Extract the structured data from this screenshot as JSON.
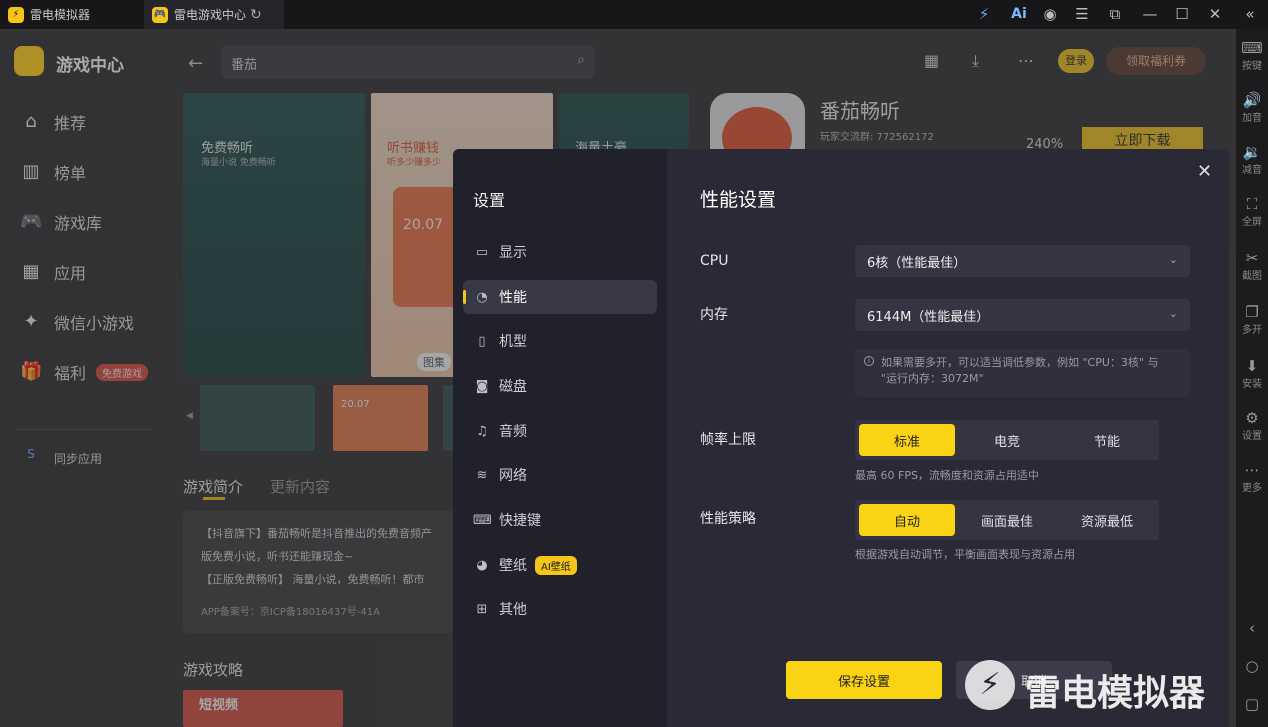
{
  "titlebar": {
    "tab1": "雷电模拟器",
    "tab2": "雷电游戏中心",
    "tab2_icon": "刷"
  },
  "rightbar": [
    {
      "icon": "⌨",
      "label": "按键"
    },
    {
      "icon": "🔊",
      "label": "加音"
    },
    {
      "icon": "🔉",
      "label": "减音"
    },
    {
      "icon": "⛶",
      "label": "全屏"
    },
    {
      "icon": "✂",
      "label": "截图"
    },
    {
      "icon": "❐",
      "label": "多开"
    },
    {
      "icon": "⬇",
      "label": "安装"
    },
    {
      "icon": "⚙",
      "label": "设置"
    },
    {
      "icon": "⋯",
      "label": "更多"
    }
  ],
  "nav": {
    "app_title": "游戏中心",
    "items": [
      {
        "icon": "⌂",
        "label": "推荐"
      },
      {
        "icon": "▥",
        "label": "榜单"
      },
      {
        "icon": "🎮",
        "label": "游戏库"
      },
      {
        "icon": "▦",
        "label": "应用"
      },
      {
        "icon": "✦",
        "label": "微信小游戏"
      },
      {
        "icon": "🎁",
        "label": "福利"
      }
    ],
    "hot_badge": "免费游戏",
    "sync": "同步应用"
  },
  "header": {
    "search_value": "番茄",
    "login": "登录",
    "welfare": "领取福利券"
  },
  "game": {
    "name": "番茄畅听",
    "group": "玩家交流群: 772562172",
    "size": "240%",
    "download": "立即下载",
    "tabs": [
      "游戏简介",
      "更新内容"
    ],
    "desc1": "【抖音旗下】番茄畅听是抖音推出的免费音频产",
    "desc2": "版免费小说，听书还能赚现金~",
    "desc3": "【正版免费畅听】 海量小说，免费畅听！都市",
    "icp": "APP备案号：京ICP备18016437号-41A",
    "strategy": "游戏攻略",
    "card1": "免费畅听",
    "card1_sub": "海量小说 免费畅听",
    "card2": "听书赚钱",
    "card2_sub": "听多少赚多少",
    "card3": "海量土豪",
    "card2_num": "20.07",
    "gallery_label": "图集",
    "thumb_num": "20.07",
    "video_label": "短视频"
  },
  "modal": {
    "sidebar_title": "设置",
    "menu": [
      {
        "icon": "▭",
        "label": "显示"
      },
      {
        "icon": "◔",
        "label": "性能"
      },
      {
        "icon": "▯",
        "label": "机型"
      },
      {
        "icon": "◙",
        "label": "磁盘"
      },
      {
        "icon": "♫",
        "label": "音频"
      },
      {
        "icon": "≋",
        "label": "网络"
      },
      {
        "icon": "⌨",
        "label": "快捷键"
      },
      {
        "icon": "◕",
        "label": "壁纸"
      },
      {
        "icon": "⊞",
        "label": "其他"
      }
    ],
    "ai_badge": "AI壁纸",
    "title": "性能设置",
    "cpu_label": "CPU",
    "cpu_value": "6核（性能最佳）",
    "mem_label": "内存",
    "mem_value": "6144M（性能最佳）",
    "hint_line1": "如果需要多开，可以适当调低参数，例如 \"CPU：3核\" 与",
    "hint_line2": "\"运行内存：3072M\"",
    "fps_label": "帧率上限",
    "fps_options": [
      "标准",
      "电竞",
      "节能"
    ],
    "fps_selected": "标准",
    "fps_desc": "最高 60 FPS，流畅度和资源占用适中",
    "strategy_label": "性能策略",
    "strategy_options": [
      "自动",
      "画面最佳",
      "资源最低"
    ],
    "strategy_selected": "自动",
    "strategy_desc": "根据游戏自动调节，平衡画面表现与资源占用",
    "save": "保存设置",
    "cancel": "取消"
  },
  "watermark": "雷电模拟器",
  "colors": {
    "accent": "#fbd315",
    "modal_bg": "#2a2a36",
    "sidebar_bg": "#21212b"
  }
}
